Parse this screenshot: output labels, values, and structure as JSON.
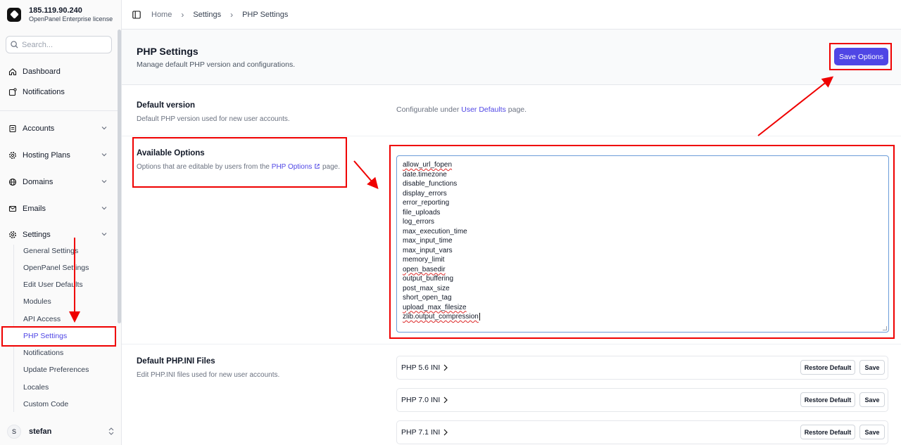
{
  "brand": {
    "ip": "185.119.90.240",
    "license": "OpenPanel Enterprise license"
  },
  "search": {
    "placeholder": "Search..."
  },
  "nav": {
    "dashboard": "Dashboard",
    "notifications": "Notifications",
    "accounts": "Accounts",
    "hosting_plans": "Hosting Plans",
    "domains": "Domains",
    "emails": "Emails",
    "settings": "Settings"
  },
  "settings_sub": [
    "General Settings",
    "OpenPanel Settings",
    "Edit User Defaults",
    "Modules",
    "API Access",
    "PHP Settings",
    "Notifications",
    "Update Preferences",
    "Locales",
    "Custom Code"
  ],
  "user": {
    "initial": "S",
    "name": "stefan"
  },
  "breadcrumb": {
    "home": "Home",
    "settings": "Settings",
    "current": "PHP Settings"
  },
  "page": {
    "title": "PHP Settings",
    "subtitle": "Manage default PHP version and configurations.",
    "save_label": "Save Options"
  },
  "default_version": {
    "title": "Default version",
    "desc": "Default PHP version used for new user accounts.",
    "note_prefix": "Configurable under ",
    "note_link": "User Defaults",
    "note_suffix": " page."
  },
  "available_options": {
    "title": "Available Options",
    "desc_prefix": "Options that are editable by users from the ",
    "desc_link": "PHP Options",
    "desc_suffix": " page.",
    "lines": [
      "allow_url_fopen",
      "date.timezone",
      "disable_functions",
      "display_errors",
      "error_reporting",
      "file_uploads",
      "log_errors",
      "max_execution_time",
      "max_input_time",
      "max_input_vars",
      "memory_limit",
      "open_basedir",
      "output_buffering",
      "post_max_size",
      "short_open_tag",
      "upload_max_filesize",
      "zlib.output_compression"
    ]
  },
  "ini_files": {
    "title": "Default PHP.INI Files",
    "desc": "Edit PHP.INI files used for new user accounts.",
    "restore_label": "Restore Default",
    "save_label": "Save",
    "items": [
      "PHP 5.6 INI",
      "PHP 7.0 INI",
      "PHP 7.1 INI"
    ]
  },
  "colors": {
    "accent": "#4f46e5",
    "annotation": "#ef0000"
  }
}
